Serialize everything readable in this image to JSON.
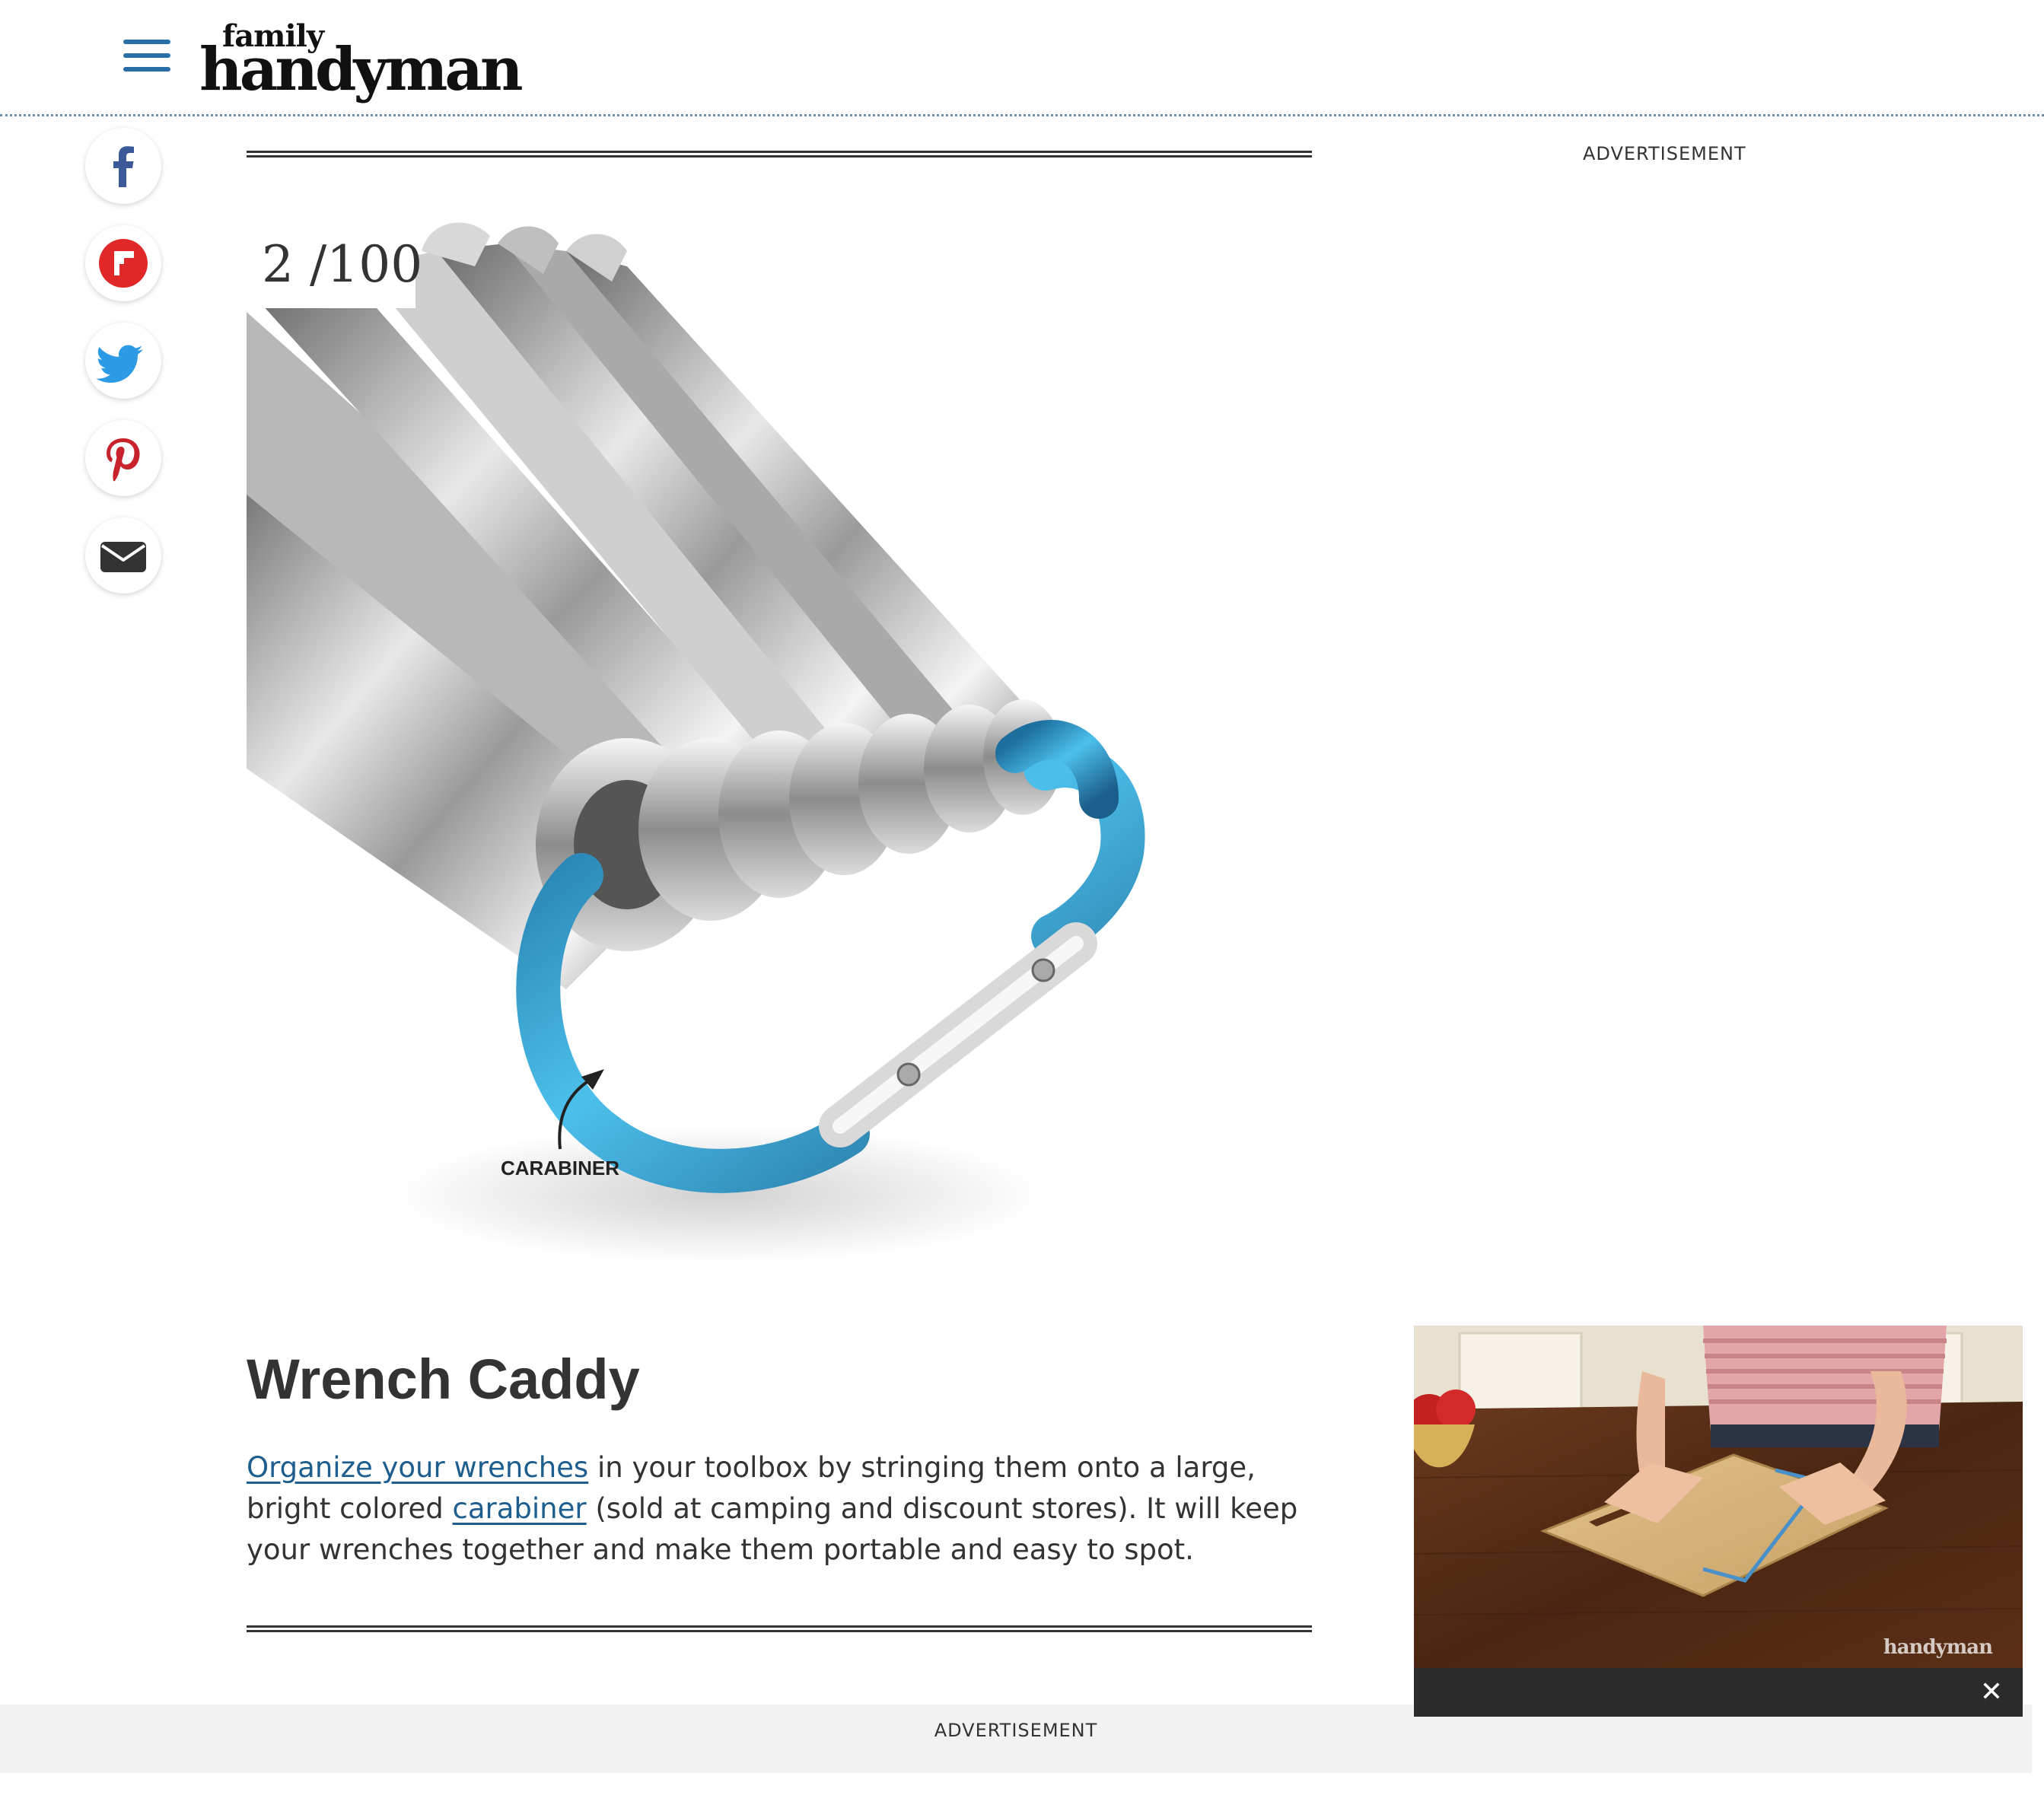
{
  "header": {
    "logo_small": "family",
    "logo_big": "handyman",
    "menu_icon": "hamburger-menu-icon"
  },
  "share": {
    "icons": [
      "facebook-icon",
      "flipboard-icon",
      "twitter-icon",
      "pinterest-icon",
      "email-icon"
    ]
  },
  "slide": {
    "number": "2 /100",
    "image_label": "CARABINER",
    "title": "Wrench Caddy",
    "body": {
      "link1": "Organize your wrenches",
      "text1": " in your toolbox by stringing them onto a large, bright colored ",
      "link2": "carabiner",
      "text2": " (sold at camping and discount stores). It will keep your wrenches together and make them portable and easy to spot."
    }
  },
  "ads": {
    "top_label": "ADVERTISEMENT",
    "bottom_label": "ADVERTISEMENT"
  },
  "video": {
    "watermark": "handyman",
    "close_label": "✕"
  },
  "colors": {
    "link": "#1d5e8e",
    "menu": "#2a6ea8",
    "carabiner": "#2f9fd0"
  }
}
